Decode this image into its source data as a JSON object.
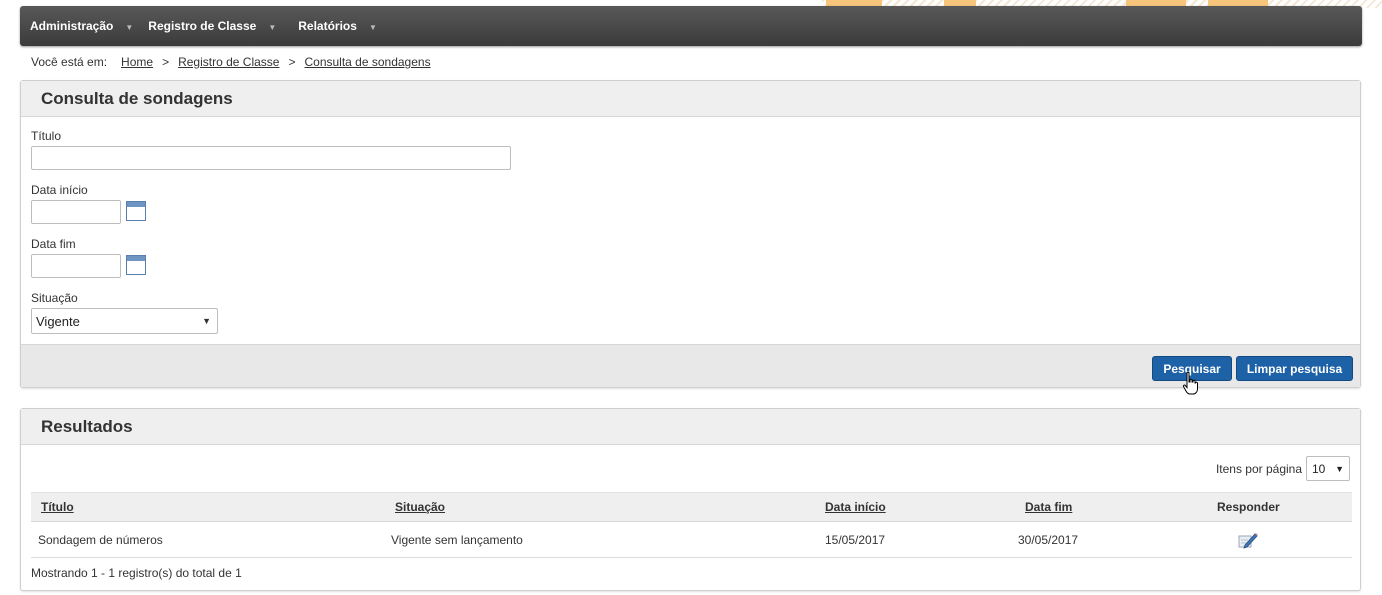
{
  "nav": {
    "items": [
      {
        "label": "Administração"
      },
      {
        "label": "Registro de Classe"
      },
      {
        "label": "Relatórios"
      }
    ]
  },
  "breadcrumb": {
    "prefix": "Você está em:",
    "items": [
      "Home",
      "Registro de Classe",
      "Consulta de sondagens"
    ],
    "separator": ">"
  },
  "search_panel": {
    "title": "Consulta de sondagens",
    "fields": {
      "titulo": {
        "label": "Título",
        "value": ""
      },
      "data_inicio": {
        "label": "Data início",
        "value": ""
      },
      "data_fim": {
        "label": "Data fim",
        "value": ""
      },
      "situacao": {
        "label": "Situação",
        "value": "Vigente"
      }
    },
    "buttons": {
      "search": "Pesquisar",
      "clear": "Limpar pesquisa"
    }
  },
  "results_panel": {
    "title": "Resultados",
    "items_per_page_label": "Itens por página",
    "items_per_page_value": "10",
    "columns": {
      "titulo": "Título",
      "situacao": "Situação",
      "data_inicio": "Data início",
      "data_fim": "Data fim",
      "responder": "Responder"
    },
    "rows": [
      {
        "titulo": "Sondagem de números",
        "situacao": "Vigente sem lançamento",
        "data_inicio": "15/05/2017",
        "data_fim": "30/05/2017",
        "action_icon": "edit-pencil-icon"
      }
    ],
    "summary": "Mostrando 1 - 1 registro(s) do total de 1"
  },
  "colors": {
    "nav_bg": "#444444",
    "button_primary": "#1d61a6",
    "panel_header_bg": "#efefef",
    "accent_orange": "#f6c47a"
  }
}
